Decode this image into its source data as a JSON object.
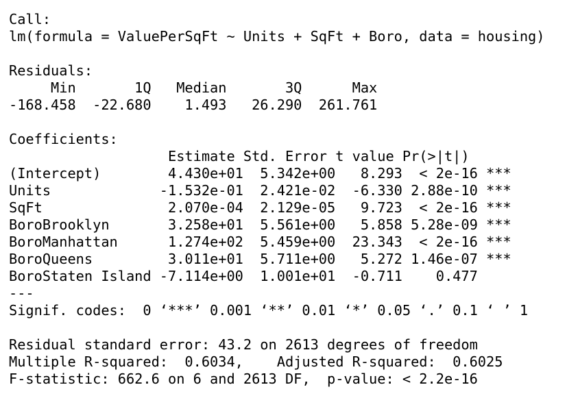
{
  "call": {
    "header": "Call:",
    "formula": "lm(formula = ValuePerSqFt ~ Units + SqFt + Boro, data = housing)"
  },
  "residuals": {
    "header": "Residuals:",
    "labels_row": "     Min       1Q   Median       3Q      Max ",
    "values_row": "-168.458  -22.680    1.493   26.290  261.761 "
  },
  "coefficients": {
    "header": "Coefficients:",
    "column_header_row": "                   Estimate Std. Error t value Pr(>|t|)    ",
    "rows": [
      {
        "term": "(Intercept)",
        "estimate": "4.430e+01",
        "std_error": "5.342e+00",
        "t_value": "8.293",
        "p_value": "< 2e-16",
        "signif": "***",
        "text": "(Intercept)        4.430e+01  5.342e+00   8.293  < 2e-16 ***"
      },
      {
        "term": "Units",
        "estimate": "-1.532e-01",
        "std_error": "2.421e-02",
        "t_value": "-6.330",
        "p_value": "2.88e-10",
        "signif": "***",
        "text": "Units             -1.532e-01  2.421e-02  -6.330 2.88e-10 ***"
      },
      {
        "term": "SqFt",
        "estimate": "2.070e-04",
        "std_error": "2.129e-05",
        "t_value": "9.723",
        "p_value": "< 2e-16",
        "signif": "***",
        "text": "SqFt               2.070e-04  2.129e-05   9.723  < 2e-16 ***"
      },
      {
        "term": "BoroBrooklyn",
        "estimate": "3.258e+01",
        "std_error": "5.561e+00",
        "t_value": "5.858",
        "p_value": "5.28e-09",
        "signif": "***",
        "text": "BoroBrooklyn       3.258e+01  5.561e+00   5.858 5.28e-09 ***"
      },
      {
        "term": "BoroManhattan",
        "estimate": "1.274e+02",
        "std_error": "5.459e+00",
        "t_value": "23.343",
        "p_value": "< 2e-16",
        "signif": "***",
        "text": "BoroManhattan      1.274e+02  5.459e+00  23.343  < 2e-16 ***"
      },
      {
        "term": "BoroQueens",
        "estimate": "3.011e+01",
        "std_error": "5.711e+00",
        "t_value": "5.272",
        "p_value": "1.46e-07",
        "signif": "***",
        "text": "BoroQueens         3.011e+01  5.711e+00   5.272 1.46e-07 ***"
      },
      {
        "term": "BoroStaten Island",
        "estimate": "-7.114e+00",
        "std_error": "1.001e+01",
        "t_value": "-0.711",
        "p_value": "0.477",
        "signif": "",
        "text": "BoroStaten Island -7.114e+00  1.001e+01  -0.711    0.477    "
      }
    ],
    "separator": "---",
    "signif_codes": "Signif. codes:  0 ‘***’ 0.001 ‘**’ 0.01 ‘*’ 0.05 ‘.’ 0.1 ‘ ’ 1"
  },
  "summary": {
    "residual_se": "Residual standard error: 43.2 on 2613 degrees of freedom",
    "r_squared": "Multiple R-squared:  0.6034,\tAdjusted R-squared:  0.6025 ",
    "f_statistic": "F-statistic: 662.6 on 6 and 2613 DF,  p-value: < 2.2e-16"
  }
}
